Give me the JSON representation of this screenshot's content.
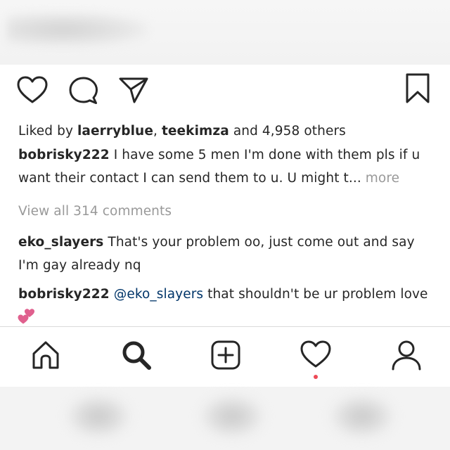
{
  "post": {
    "likes": {
      "prefix": "Liked by ",
      "user1": "laerryblue",
      "separator": ", ",
      "user2": "teekimza",
      "suffix": " and 4,958 others"
    },
    "caption": {
      "username": "bobrisky222",
      "text": " I have some 5 men I'm done with them pls if u want their contact I can send them to u. U might t...",
      "more_label": " more"
    },
    "view_all_comments": "View all 314 comments",
    "comments": [
      {
        "username": "eko_slayers",
        "text": " That's your problem oo, just come out and say I'm gay already nq"
      },
      {
        "username": "bobrisky222",
        "mention": " @eko_slayers",
        "text": " that shouldn't be ur problem love"
      }
    ],
    "reaction_emoji": "two-hearts-icon"
  },
  "action_icons": [
    "heart-icon",
    "comment-icon",
    "share-icon",
    "bookmark-icon"
  ],
  "tab_icons": [
    "home-icon",
    "search-icon",
    "new-post-icon",
    "activity-icon",
    "profile-icon"
  ],
  "colors": {
    "text": "#262626",
    "muted": "#999999",
    "mention": "#003569",
    "notification_dot": "#ed4956",
    "hearts": "#e0608e"
  }
}
